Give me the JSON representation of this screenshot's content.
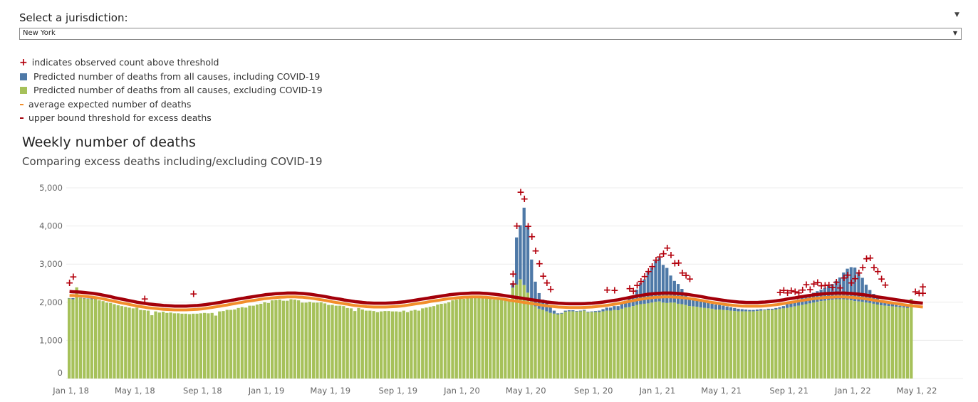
{
  "selector": {
    "label": "Select a jurisdiction:",
    "value": "New York"
  },
  "legend": [
    {
      "symbol": "plus",
      "color": "#b3000c",
      "label": "indicates observed count above threshold"
    },
    {
      "symbol": "square",
      "color": "#4e79a7",
      "label": "Predicted number of deaths from all causes, including COVID-19"
    },
    {
      "symbol": "square",
      "color": "#a6c15a",
      "label": "Predicted number of deaths from all causes, excluding COVID-19"
    },
    {
      "symbol": "dash",
      "color": "#f28e2b",
      "label": "average expected number of deaths"
    },
    {
      "symbol": "dash",
      "color": "#a3000a",
      "label": "upper bound threshold for excess deaths"
    }
  ],
  "colors": {
    "including_covid": "#4e79a7",
    "excluding_covid": "#a6c15a",
    "expected": "#f28e2b",
    "threshold": "#a3000a",
    "marker": "#b3000c"
  },
  "chart_data": {
    "type": "bar",
    "title": "Weekly number of deaths",
    "subtitle": "Comparing excess deaths including/excluding COVID-19",
    "ylim": [
      0,
      5000
    ],
    "y_ticks": [
      "5,000",
      "4,000",
      "3,000",
      "2,000",
      "1,000",
      "0"
    ],
    "x_ticks": [
      {
        "label": "Jan 1, 18",
        "week": 0
      },
      {
        "label": "May 1, 18",
        "week": 17
      },
      {
        "label": "Sep 1, 18",
        "week": 35
      },
      {
        "label": "Jan 1, 19",
        "week": 52
      },
      {
        "label": "May 1, 19",
        "week": 69
      },
      {
        "label": "Sep 1, 19",
        "week": 87
      },
      {
        "label": "Jan 1, 20",
        "week": 104
      },
      {
        "label": "May 1, 20",
        "week": 121
      },
      {
        "label": "Sep 1, 20",
        "week": 139
      },
      {
        "label": "Jan 1, 21",
        "week": 156
      },
      {
        "label": "May 1, 21",
        "week": 173
      },
      {
        "label": "Sep 1, 21",
        "week": 191
      },
      {
        "label": "Jan 1, 22",
        "week": 208
      },
      {
        "label": "May 1, 22",
        "week": 225
      }
    ],
    "grid": true,
    "first_week": "Dec 30, 17",
    "including_covid": [
      2110,
      2110,
      2390,
      2120,
      2110,
      2100,
      2100,
      2100,
      2050,
      2030,
      1990,
      1980,
      1950,
      1920,
      1900,
      1880,
      1860,
      1840,
      1860,
      1800,
      1790,
      1780,
      1660,
      1760,
      1730,
      1750,
      1720,
      1730,
      1710,
      1710,
      1700,
      1700,
      1690,
      1700,
      1700,
      1710,
      1720,
      1710,
      1720,
      1650,
      1760,
      1770,
      1800,
      1800,
      1810,
      1850,
      1870,
      1860,
      1910,
      1910,
      1940,
      1960,
      2000,
      1980,
      2050,
      2060,
      2070,
      2040,
      2040,
      2080,
      2070,
      2050,
      1990,
      1990,
      2010,
      1990,
      1990,
      2000,
      1970,
      1930,
      1930,
      1910,
      1910,
      1900,
      1850,
      1840,
      1770,
      1850,
      1810,
      1780,
      1780,
      1770,
      1740,
      1760,
      1770,
      1770,
      1760,
      1760,
      1750,
      1780,
      1740,
      1780,
      1800,
      1780,
      1840,
      1860,
      1880,
      1900,
      1940,
      1960,
      1970,
      2000,
      2050,
      2070,
      2100,
      2090,
      2140,
      2150,
      2130,
      2130,
      2150,
      2130,
      2120,
      2070,
      2080,
      2080,
      2040,
      2050,
      2500,
      3700,
      4020,
      4480,
      4010,
      3120,
      2540,
      2240,
      2070,
      1970,
      1870,
      1780,
      1710,
      1720,
      1780,
      1790,
      1790,
      1770,
      1780,
      1800,
      1750,
      1760,
      1770,
      1780,
      1820,
      1860,
      1860,
      1900,
      1900,
      1960,
      2040,
      2090,
      2170,
      2330,
      2500,
      2600,
      2820,
      2910,
      3080,
      3160,
      2980,
      2900,
      2700,
      2560,
      2480,
      2350,
      2220,
      2130,
      2060,
      2040,
      2020,
      2010,
      1990,
      1960,
      1940,
      1930,
      1910,
      1890,
      1870,
      1850,
      1830,
      1820,
      1810,
      1800,
      1800,
      1810,
      1820,
      1810,
      1830,
      1830,
      1850,
      1870,
      1900,
      1950,
      1980,
      2020,
      2080,
      2120,
      2160,
      2200,
      2250,
      2290,
      2330,
      2380,
      2430,
      2480,
      2560,
      2650,
      2780,
      2880,
      2920,
      2910,
      2790,
      2640,
      2460,
      2320,
      2220,
      2140,
      2060,
      2000,
      1970,
      1950,
      1930,
      1910,
      1900,
      1890,
      1880,
      1870,
      2130
    ],
    "excluding_covid": [
      2100,
      2080,
      2390,
      2110,
      2100,
      2090,
      2080,
      2080,
      2050,
      2030,
      1990,
      1980,
      1950,
      1920,
      1900,
      1880,
      1860,
      1840,
      1860,
      1800,
      1790,
      1780,
      1660,
      1760,
      1730,
      1750,
      1720,
      1730,
      1710,
      1710,
      1700,
      1700,
      1690,
      1700,
      1700,
      1710,
      1720,
      1710,
      1720,
      1650,
      1760,
      1770,
      1800,
      1800,
      1810,
      1850,
      1870,
      1860,
      1910,
      1910,
      1940,
      1960,
      2000,
      1980,
      2050,
      2060,
      2070,
      2040,
      2040,
      2080,
      2070,
      2050,
      1990,
      1990,
      2010,
      1990,
      1990,
      2000,
      1970,
      1930,
      1930,
      1910,
      1910,
      1900,
      1850,
      1840,
      1770,
      1850,
      1810,
      1780,
      1780,
      1770,
      1740,
      1760,
      1770,
      1770,
      1760,
      1760,
      1750,
      1780,
      1740,
      1780,
      1800,
      1780,
      1840,
      1860,
      1880,
      1900,
      1940,
      1960,
      1970,
      2000,
      2050,
      2070,
      2100,
      2090,
      2140,
      2150,
      2130,
      2130,
      2150,
      2130,
      2120,
      2070,
      2080,
      2080,
      2040,
      2050,
      2380,
      2460,
      2600,
      2450,
      2250,
      2020,
      1890,
      1830,
      1800,
      1760,
      1720,
      1700,
      1680,
      1700,
      1750,
      1760,
      1760,
      1750,
      1760,
      1780,
      1730,
      1740,
      1740,
      1740,
      1760,
      1780,
      1780,
      1800,
      1790,
      1830,
      1860,
      1870,
      1900,
      1930,
      1950,
      1960,
      1970,
      1990,
      2010,
      2020,
      1990,
      1980,
      1990,
      1990,
      1960,
      1950,
      1930,
      1900,
      1890,
      1880,
      1860,
      1850,
      1840,
      1830,
      1810,
      1810,
      1800,
      1790,
      1780,
      1770,
      1760,
      1760,
      1760,
      1760,
      1760,
      1770,
      1780,
      1790,
      1800,
      1800,
      1810,
      1830,
      1840,
      1850,
      1870,
      1890,
      1910,
      1930,
      1950,
      1970,
      1990,
      2010,
      2030,
      2040,
      2060,
      2070,
      2080,
      2080,
      2080,
      2070,
      2050,
      2030,
      2020,
      2010,
      1990,
      1980,
      1960,
      1940,
      1920,
      1910,
      1900,
      1890,
      1880,
      1870,
      1860,
      1850,
      2090
    ],
    "expected": [
      2180,
      2175,
      2170,
      2165,
      2155,
      2145,
      2135,
      2120,
      2105,
      2085,
      2065,
      2045,
      2020,
      2000,
      1980,
      1960,
      1940,
      1920,
      1900,
      1885,
      1870,
      1855,
      1845,
      1835,
      1825,
      1815,
      1810,
      1805,
      1800,
      1800,
      1800,
      1800,
      1805,
      1810,
      1815,
      1825,
      1835,
      1850,
      1865,
      1880,
      1895,
      1915,
      1930,
      1950,
      1965,
      1985,
      2000,
      2020,
      2035,
      2050,
      2065,
      2080,
      2095,
      2105,
      2115,
      2125,
      2130,
      2135,
      2140,
      2140,
      2140,
      2135,
      2130,
      2120,
      2110,
      2095,
      2080,
      2065,
      2050,
      2030,
      2010,
      1995,
      1980,
      1960,
      1945,
      1930,
      1915,
      1905,
      1895,
      1885,
      1880,
      1875,
      1875,
      1875,
      1875,
      1880,
      1885,
      1890,
      1900,
      1910,
      1925,
      1940,
      1955,
      1970,
      1985,
      2000,
      2020,
      2035,
      2050,
      2065,
      2080,
      2095,
      2105,
      2115,
      2125,
      2130,
      2135,
      2140,
      2140,
      2140,
      2135,
      2130,
      2120,
      2110,
      2100,
      2085,
      2070,
      2055,
      2040,
      2025,
      2010,
      1995,
      1980,
      1965,
      1950,
      1935,
      1920,
      1905,
      1895,
      1885,
      1875,
      1870,
      1865,
      1860,
      1860,
      1860,
      1860,
      1865,
      1870,
      1875,
      1885,
      1895,
      1905,
      1920,
      1935,
      1950,
      1965,
      1985,
      2005,
      2025,
      2045,
      2065,
      2080,
      2095,
      2110,
      2120,
      2130,
      2135,
      2140,
      2140,
      2140,
      2135,
      2130,
      2120,
      2110,
      2095,
      2080,
      2065,
      2050,
      2030,
      2010,
      1995,
      1980,
      1965,
      1950,
      1935,
      1925,
      1915,
      1905,
      1900,
      1895,
      1895,
      1895,
      1895,
      1900,
      1905,
      1915,
      1925,
      1935,
      1950,
      1965,
      1985,
      2000,
      2015,
      2035,
      2050,
      2065,
      2080,
      2095,
      2105,
      2115,
      2125,
      2130,
      2135,
      2140,
      2140,
      2140,
      2135,
      2130,
      2120,
      2110,
      2100,
      2085,
      2070,
      2055,
      2040,
      2025,
      2010,
      1995,
      1980,
      1965,
      1950,
      1935,
      1920,
      1905,
      1895,
      1885,
      1875
    ],
    "threshold": [
      2280,
      2275,
      2270,
      2265,
      2255,
      2245,
      2235,
      2220,
      2205,
      2185,
      2165,
      2145,
      2120,
      2100,
      2080,
      2060,
      2040,
      2020,
      2000,
      1985,
      1970,
      1955,
      1945,
      1935,
      1925,
      1915,
      1910,
      1905,
      1900,
      1900,
      1900,
      1900,
      1905,
      1910,
      1915,
      1925,
      1935,
      1950,
      1965,
      1980,
      1995,
      2015,
      2030,
      2050,
      2065,
      2085,
      2100,
      2120,
      2135,
      2150,
      2165,
      2180,
      2195,
      2205,
      2215,
      2225,
      2230,
      2235,
      2240,
      2240,
      2240,
      2235,
      2230,
      2220,
      2210,
      2195,
      2180,
      2165,
      2150,
      2130,
      2110,
      2095,
      2080,
      2060,
      2045,
      2030,
      2015,
      2005,
      1995,
      1985,
      1980,
      1975,
      1975,
      1975,
      1975,
      1980,
      1985,
      1990,
      2000,
      2010,
      2025,
      2040,
      2055,
      2070,
      2085,
      2100,
      2120,
      2135,
      2150,
      2165,
      2180,
      2195,
      2205,
      2215,
      2225,
      2230,
      2235,
      2240,
      2240,
      2240,
      2235,
      2230,
      2220,
      2210,
      2200,
      2185,
      2170,
      2155,
      2140,
      2125,
      2110,
      2095,
      2080,
      2065,
      2050,
      2035,
      2020,
      2005,
      1995,
      1985,
      1975,
      1970,
      1965,
      1960,
      1960,
      1960,
      1960,
      1965,
      1970,
      1975,
      1985,
      1995,
      2005,
      2020,
      2035,
      2050,
      2065,
      2085,
      2105,
      2125,
      2145,
      2165,
      2180,
      2195,
      2210,
      2220,
      2230,
      2235,
      2240,
      2240,
      2240,
      2235,
      2230,
      2220,
      2210,
      2195,
      2180,
      2165,
      2150,
      2130,
      2110,
      2095,
      2080,
      2065,
      2050,
      2035,
      2025,
      2015,
      2005,
      2000,
      1995,
      1995,
      1995,
      1995,
      2000,
      2005,
      2015,
      2025,
      2035,
      2050,
      2065,
      2085,
      2100,
      2115,
      2135,
      2150,
      2165,
      2180,
      2195,
      2205,
      2215,
      2225,
      2230,
      2235,
      2240,
      2240,
      2240,
      2235,
      2230,
      2220,
      2210,
      2200,
      2185,
      2170,
      2155,
      2140,
      2125,
      2110,
      2095,
      2080,
      2065,
      2050,
      2035,
      2020,
      2005,
      1995,
      1985,
      1975
    ],
    "above_threshold_weeks": [
      {
        "week": 0,
        "value": 2520
      },
      {
        "week": 1,
        "value": 2680
      },
      {
        "week": 20,
        "value": 2100
      },
      {
        "week": 33,
        "value": 2230
      },
      {
        "week": 118,
        "value": 2490
      },
      {
        "week": 118,
        "value": 2750
      },
      {
        "week": 119,
        "value": 4010
      },
      {
        "week": 120,
        "value": 4900
      },
      {
        "week": 121,
        "value": 4720
      },
      {
        "week": 122,
        "value": 4000
      },
      {
        "week": 123,
        "value": 3730
      },
      {
        "week": 124,
        "value": 3360
      },
      {
        "week": 125,
        "value": 3020
      },
      {
        "week": 126,
        "value": 2700
      },
      {
        "week": 127,
        "value": 2520
      },
      {
        "week": 128,
        "value": 2350
      },
      {
        "week": 143,
        "value": 2330
      },
      {
        "week": 145,
        "value": 2320
      },
      {
        "week": 149,
        "value": 2370
      },
      {
        "week": 150,
        "value": 2300
      },
      {
        "week": 151,
        "value": 2450
      },
      {
        "week": 152,
        "value": 2560
      },
      {
        "week": 153,
        "value": 2690
      },
      {
        "week": 154,
        "value": 2820
      },
      {
        "week": 155,
        "value": 2950
      },
      {
        "week": 156,
        "value": 3120
      },
      {
        "week": 157,
        "value": 3200
      },
      {
        "week": 158,
        "value": 3280
      },
      {
        "week": 159,
        "value": 3430
      },
      {
        "week": 160,
        "value": 3250
      },
      {
        "week": 161,
        "value": 3030
      },
      {
        "week": 162,
        "value": 3040
      },
      {
        "week": 163,
        "value": 2780
      },
      {
        "week": 164,
        "value": 2710
      },
      {
        "week": 165,
        "value": 2620
      },
      {
        "week": 189,
        "value": 2270
      },
      {
        "week": 190,
        "value": 2320
      },
      {
        "week": 191,
        "value": 2260
      },
      {
        "week": 192,
        "value": 2310
      },
      {
        "week": 193,
        "value": 2290
      },
      {
        "week": 194,
        "value": 2260
      },
      {
        "week": 195,
        "value": 2330
      },
      {
        "week": 196,
        "value": 2470
      },
      {
        "week": 197,
        "value": 2340
      },
      {
        "week": 198,
        "value": 2490
      },
      {
        "week": 199,
        "value": 2530
      },
      {
        "week": 200,
        "value": 2440
      },
      {
        "week": 201,
        "value": 2450
      },
      {
        "week": 202,
        "value": 2460
      },
      {
        "week": 203,
        "value": 2400
      },
      {
        "week": 204,
        "value": 2540
      },
      {
        "week": 205,
        "value": 2390
      },
      {
        "week": 206,
        "value": 2650
      },
      {
        "week": 207,
        "value": 2720
      },
      {
        "week": 208,
        "value": 2520
      },
      {
        "week": 209,
        "value": 2630
      },
      {
        "week": 210,
        "value": 2780
      },
      {
        "week": 211,
        "value": 2920
      },
      {
        "week": 212,
        "value": 3150
      },
      {
        "week": 213,
        "value": 3170
      },
      {
        "week": 214,
        "value": 2920
      },
      {
        "week": 215,
        "value": 2820
      },
      {
        "week": 216,
        "value": 2620
      },
      {
        "week": 217,
        "value": 2460
      },
      {
        "week": 225,
        "value": 2290
      },
      {
        "week": 226,
        "value": 2250
      },
      {
        "week": 227,
        "value": 2420
      },
      {
        "week": 227,
        "value": 2250
      }
    ]
  }
}
